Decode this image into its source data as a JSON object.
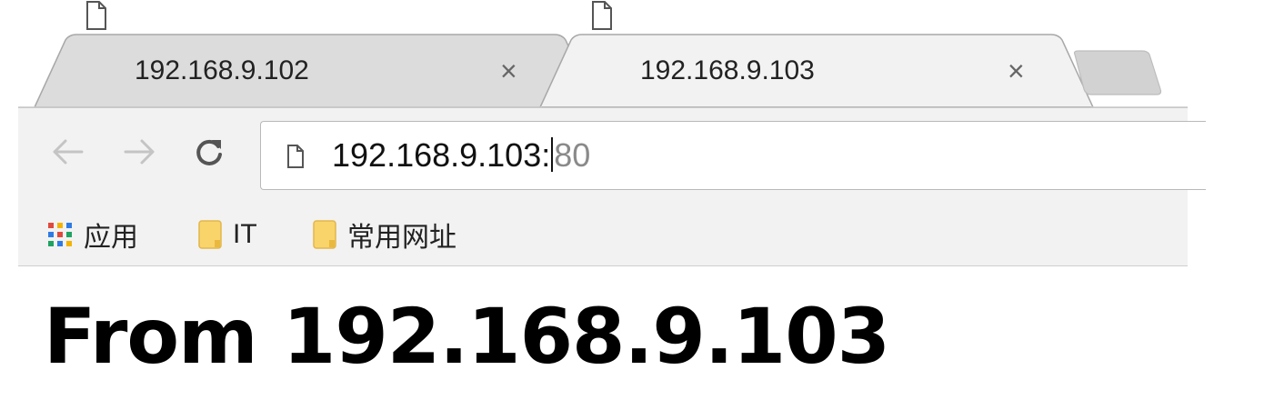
{
  "tabs": [
    {
      "title": "192.168.9.102",
      "active": false,
      "close": "×"
    },
    {
      "title": "192.168.9.103",
      "active": true,
      "close": "×"
    }
  ],
  "toolbar": {
    "back_icon": "back-arrow-icon",
    "forward_icon": "forward-arrow-icon",
    "reload_icon": "reload-icon",
    "address": {
      "host": "192.168.9.103:",
      "port": "80"
    }
  },
  "bookmarks": [
    {
      "label": "应用",
      "icon": "apps-grid-icon"
    },
    {
      "label": "IT",
      "icon": "folder-icon"
    },
    {
      "label": "常用网址",
      "icon": "folder-icon"
    }
  ],
  "page": {
    "heading": "From 192.168.9.103"
  },
  "colors": {
    "tab_active_bg": "#f2f2f2",
    "tab_inactive_bg": "#dcdcdc",
    "toolbar_bg": "#f2f2f2",
    "folder_yellow": "#f9d46b",
    "port_gray": "#8a8a8a"
  }
}
